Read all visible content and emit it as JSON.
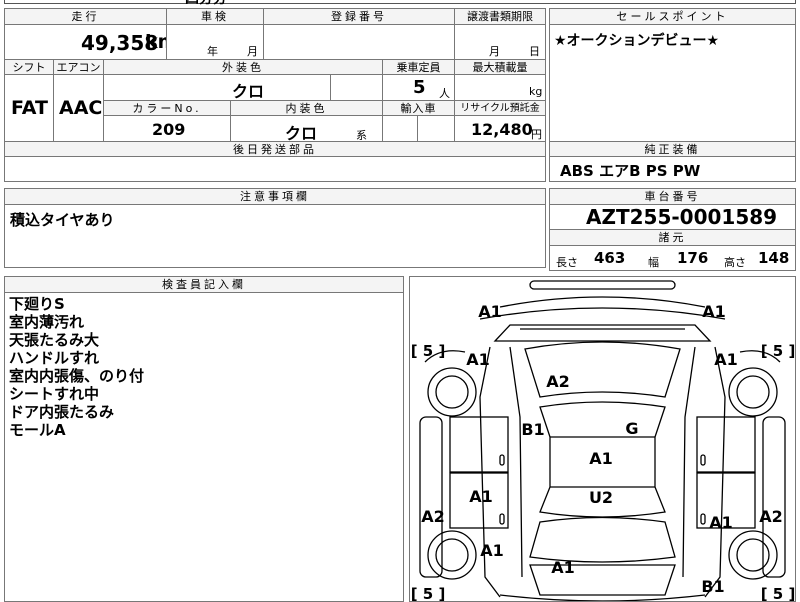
{
  "top": {
    "partial_text": "四分分"
  },
  "mileage": {
    "label": "走行",
    "value": "49,358",
    "unit": "km"
  },
  "inspection": {
    "label": "車検",
    "year_suffix": "年",
    "month_suffix": "月"
  },
  "registration": {
    "label": "登録番号",
    "value": ""
  },
  "transfer_deadline": {
    "label": "譲渡書類期限",
    "month_suffix": "月",
    "day_suffix": "日"
  },
  "sales_point": {
    "label": "セールスポイント",
    "text": "★オークションデビュー★"
  },
  "shift": {
    "label": "シフト",
    "value": "FAT"
  },
  "aircon": {
    "label": "エアコン",
    "value": "AAC"
  },
  "exterior_color": {
    "label": "外装色",
    "value": "クロ"
  },
  "capacity": {
    "label": "乗車定員",
    "value": "5",
    "unit": "人"
  },
  "max_load": {
    "label": "最大積載量",
    "unit": "kg"
  },
  "color_no": {
    "label": "カラーNo.",
    "value": "209"
  },
  "interior_color": {
    "label": "内装色",
    "value": "クロ",
    "suffix": "系"
  },
  "import": {
    "label": "輸入車"
  },
  "recycle": {
    "label": "リサイクル預託金",
    "value": "12,480",
    "unit": "円"
  },
  "later_parts": {
    "label": "後日発送部品",
    "value": ""
  },
  "equipment": {
    "label": "純正装備",
    "value": "ABS エアB PS PW"
  },
  "notes": {
    "label": "注意事項欄",
    "value": "積込タイヤあり"
  },
  "chassis": {
    "label": "車台番号",
    "value": "AZT255-0001589"
  },
  "dimensions": {
    "label": "諸元",
    "length_label": "長さ",
    "length": "463",
    "width_label": "幅",
    "width": "176",
    "height_label": "高さ",
    "height": "148"
  },
  "inspector": {
    "label": "検査員記入欄",
    "lines": [
      "下廻りS",
      "室内薄汚れ",
      "天張たるみ大",
      "ハンドルすれ",
      "室内内張傷、のり付",
      "シートすれ中",
      "ドア内張たるみ",
      "モールA"
    ]
  },
  "diagram": {
    "marks": [
      "A1",
      "A1",
      "A1",
      "A1",
      "A2",
      "B1",
      "G",
      "A1",
      "U2",
      "A1",
      "A1",
      "A2",
      "A2",
      "A1",
      "A1",
      "B1"
    ],
    "tire_labels": [
      "[ 5 ]",
      "[ 5 ]",
      "[ 5 ]",
      "[ 5 ]"
    ]
  }
}
